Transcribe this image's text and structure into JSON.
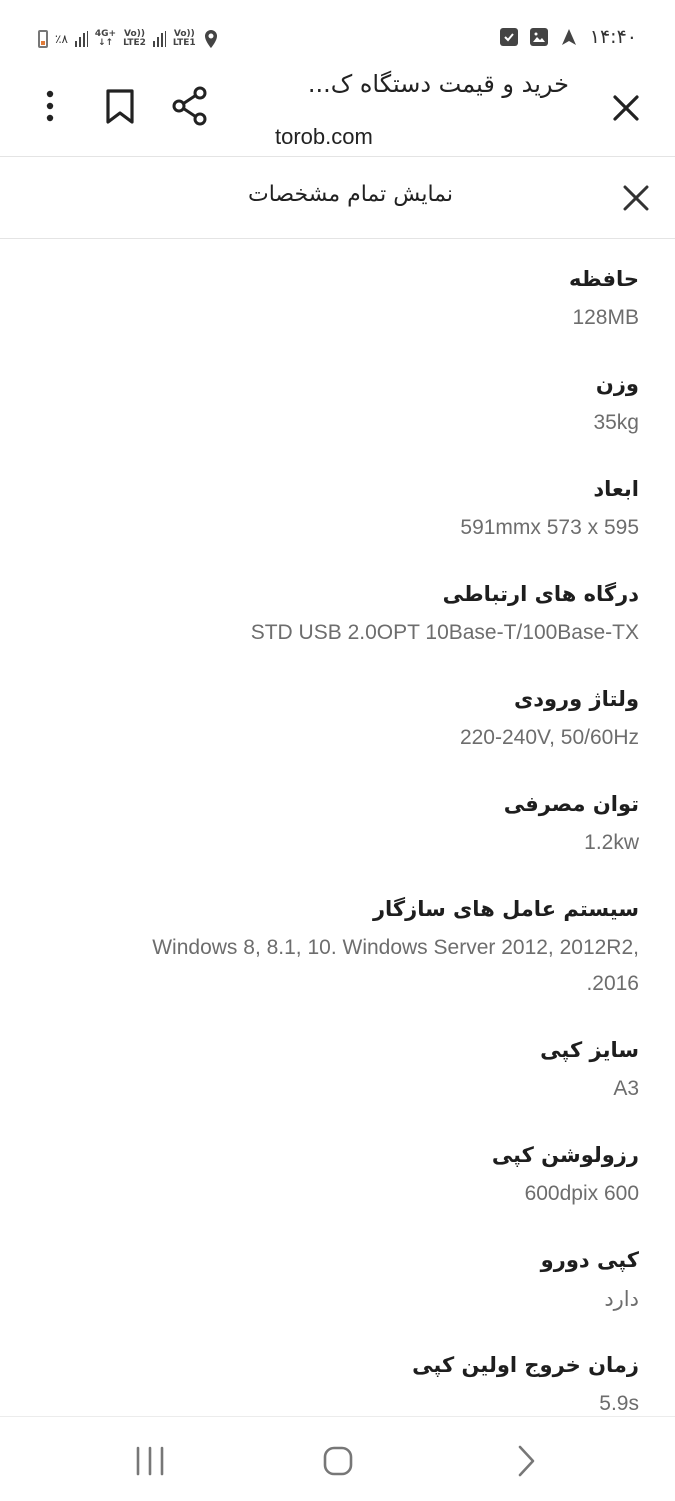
{
  "status_bar": {
    "battery": "٪۸",
    "sim1_network": "4G+",
    "sim1_lte": "LTE2",
    "sim1_volte": "Vo))",
    "sim2_volte": "Vo))",
    "sim2_lte": "LTE1",
    "time": "۱۴:۴۰"
  },
  "top_bar": {
    "title": "خرید و قیمت دستگاه ک...",
    "url": "torob.com"
  },
  "panel": {
    "title": "نمایش تمام مشخصات"
  },
  "specs": [
    {
      "label": "حافظه",
      "value": "128MB"
    },
    {
      "label": "وزن",
      "value": "35kg"
    },
    {
      "label": "ابعاد",
      "value": "591mmx 573 x 595"
    },
    {
      "label": "درگاه های ارتباطی",
      "value": "STD USB 2.0OPT 10Base-T/100Base-TX"
    },
    {
      "label": "ولتاژ ورودی",
      "value": "220-240V, 50/60Hz"
    },
    {
      "label": "توان مصرفی",
      "value": "1.2kw"
    },
    {
      "label": "سیستم عامل های سازگار",
      "value": "Windows 8, 8.1, 10. Windows Server 2012, 2012R2,",
      "value_line2": ".2016"
    },
    {
      "label": "سایز کپی",
      "value": "A3"
    },
    {
      "label": "رزولوشن کپی",
      "value": "600dpix 600"
    },
    {
      "label": "کپی دورو",
      "value": "دارد"
    },
    {
      "label": "زمان خروج اولین کپی",
      "value": "5.9s"
    }
  ]
}
